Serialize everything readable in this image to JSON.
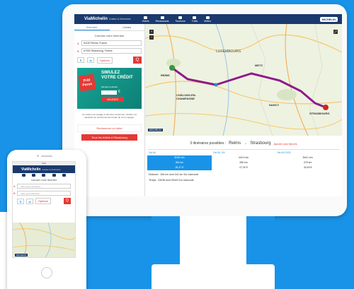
{
  "header": {
    "top_links": "Navigation • Réserver un hôtel",
    "brand": "ViaMichelin",
    "brand_sub": "Guides & Itinéraires",
    "nav": [
      "Hôtels",
      "Restaurants",
      "Tourisme",
      "Trafic",
      "Météo"
    ],
    "partner": "MICHELIN"
  },
  "left_panel": {
    "tab_itineraries": "Itinéraire",
    "tab_maps": "Cartes",
    "calc_title": "Calculez votre itinéraire",
    "from_label": "A",
    "from_value": "51100 Reims, France",
    "to_label": "B",
    "to_value": "67000 Strasbourg, France",
    "options_label": "Options",
    "go_label": "Q"
  },
  "ad": {
    "badge": "Prêt Perso",
    "headline_1": "SIMULEZ",
    "headline_2": "VOTRE CRÉDIT",
    "amount_hint": "Montant souhaité",
    "currency": "€",
    "validate": "VALIDEZ",
    "fineprint": "Un crédit vous engage et doit être remboursé. Vérifiez vos capacités de remboursement avant de vous engager."
  },
  "map": {
    "labels": [
      "LUXEMBOURG",
      "REIMS",
      "CHÂLONS-EN-CHAMPAGNE",
      "METZ",
      "NANCY",
      "STRASBOURG"
    ],
    "scale_logo": "MICHELIN"
  },
  "results": {
    "count_label": "3 itinéraires possibles :",
    "origin": "Reims",
    "arrow": "→",
    "destination": "Strasbourg",
    "favourite": "Ajouter aux favoris",
    "routes": [
      "Via A4",
      "Via D4, N4",
      "Via A4 D232"
    ],
    "rows": [
      [
        "3h38 min",
        "4h19 min",
        "3h51 min"
      ],
      [
        "364 km",
        "356 km",
        "378 km"
      ],
      [
        "28,47 €",
        "47,30 €",
        "30,69 €"
      ]
    ],
    "distance_line": "Distance : 364 km dont 341 km Sur autoroute",
    "time_line": "Temps : 03h38 dont 03h16 Sur autoroute"
  },
  "hotel_cta": {
    "search": "Rechercher un hôtel",
    "all_hotels": "Tous les hôtels à Strasbourg"
  },
  "phone": {
    "status": "9:41",
    "brand": "ViaMichelin",
    "brand_sub": "Guides & Itinéraires",
    "calc_title": "Calculez votre itinéraire",
    "from_placeholder": "Votre point de départ...",
    "to_placeholder": "Votre point d'arrivée...",
    "options_label": "Options",
    "go_label": "Q",
    "map_logo": "MICHELIN"
  },
  "colors": {
    "background": "#1893e8",
    "header": "#1a3a6e",
    "accent_red": "#e53935",
    "ad_teal": "#17a596",
    "route_purple": "#8e1b8a"
  }
}
